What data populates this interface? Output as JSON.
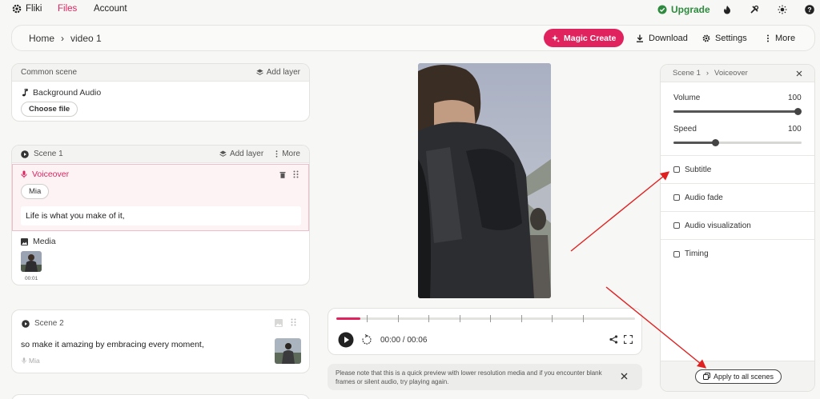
{
  "nav": {
    "fliki": "Fliki",
    "files": "Files",
    "account": "Account",
    "upgrade": "Upgrade"
  },
  "breadcrumb": {
    "home": "Home",
    "sep": "›",
    "current": "video 1"
  },
  "toolbar": {
    "magic_create": "Magic Create",
    "download": "Download",
    "settings": "Settings",
    "more": "More"
  },
  "common_scene": {
    "title": "Common scene",
    "add_layer": "Add layer",
    "bg_audio": "Background Audio",
    "choose_file": "Choose file"
  },
  "scene1": {
    "title": "Scene 1",
    "add_layer": "Add layer",
    "more": "More",
    "voiceover": "Voiceover",
    "voice": "Mia",
    "text": "Life is what you make of it,",
    "media": "Media",
    "media_duration": "00:01"
  },
  "scene2": {
    "title": "Scene 2",
    "text": "so make it amazing by embracing every moment,",
    "voice": "Mia"
  },
  "player": {
    "time": "00:00 / 00:06",
    "progress": 0.08
  },
  "notice": "Please note that this is a quick preview with lower resolution media and if you encounter blank frames or silent audio, try playing again.",
  "voice_panel": {
    "crumb_scene": "Scene 1",
    "crumb_sep": "›",
    "crumb_item": "Voiceover",
    "volume_label": "Volume",
    "volume_value": "100",
    "volume_level": 1.0,
    "speed_label": "Speed",
    "speed_value": "100",
    "speed_level": 0.33,
    "options": [
      "Subtitle",
      "Audio fade",
      "Audio visualization",
      "Timing"
    ],
    "apply_all": "Apply to all scenes"
  },
  "colors": {
    "accent": "#e0235f",
    "upgrade_green": "#2e8a3e",
    "annotation_red": "#e02020"
  }
}
